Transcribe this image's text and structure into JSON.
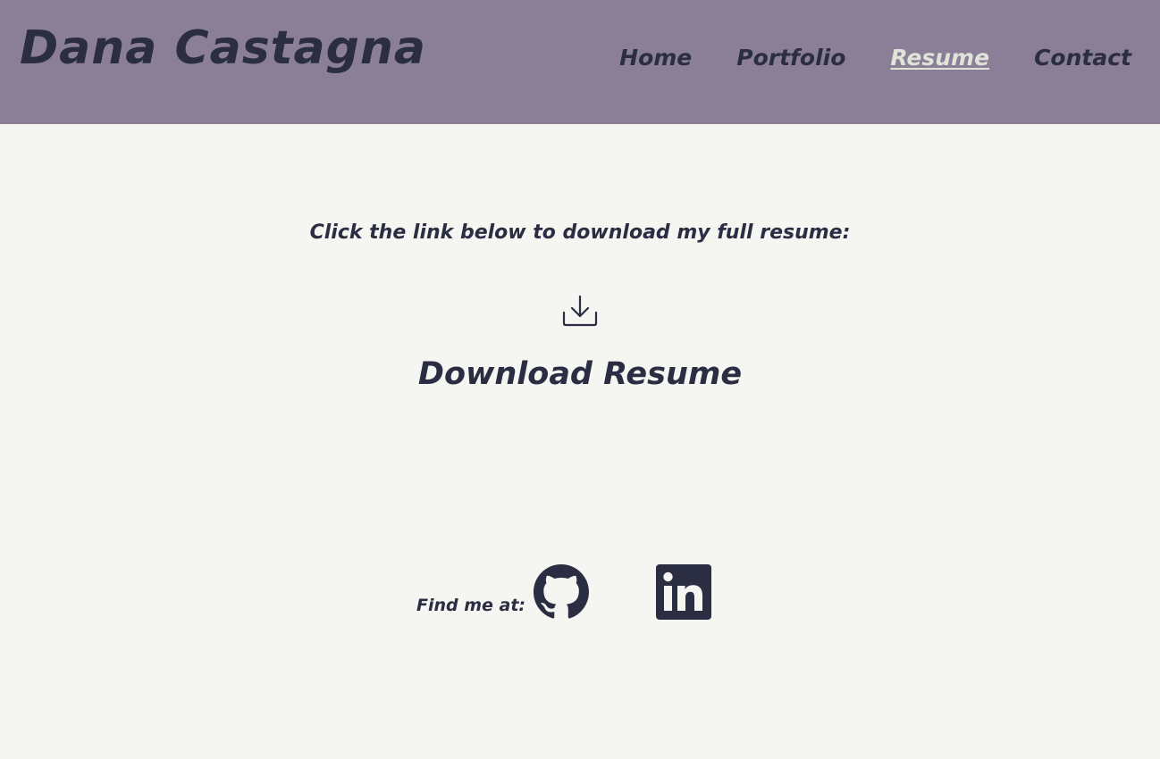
{
  "header": {
    "site_title": "Dana Castagna",
    "nav": [
      {
        "label": "Home",
        "active": false
      },
      {
        "label": "Portfolio",
        "active": false
      },
      {
        "label": "Resume",
        "active": true
      },
      {
        "label": "Contact",
        "active": false
      }
    ]
  },
  "main": {
    "intro_text": "Click the link below to download my full resume:",
    "download": {
      "icon": "download-icon",
      "label": "Download Resume"
    }
  },
  "footer": {
    "find_label": "Find me at:",
    "social_links": [
      {
        "icon": "github-icon"
      },
      {
        "icon": "linkedin-icon"
      }
    ]
  },
  "colors": {
    "header_bg": "#8a7f97",
    "page_bg": "#f5f5f1",
    "text": "#2b2d42",
    "active_nav": "#dfe3d8"
  }
}
